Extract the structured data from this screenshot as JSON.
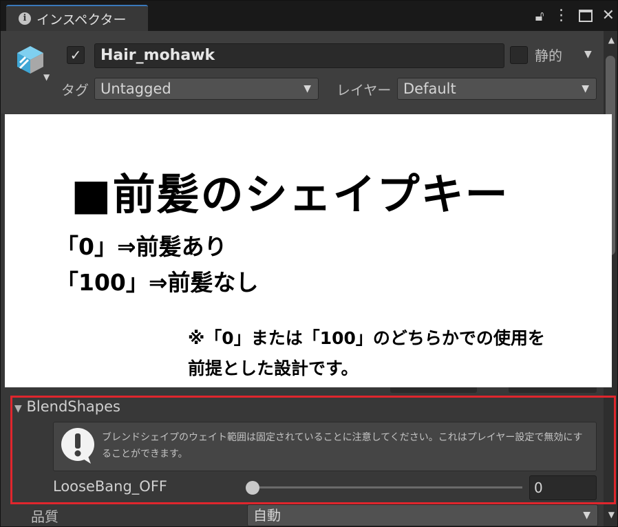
{
  "tab": {
    "title": "インスペクター",
    "icons": [
      "info-icon",
      "lock-icon",
      "kebab-menu-icon",
      "maximize-icon",
      "close-icon"
    ]
  },
  "object": {
    "active": true,
    "name": "Hair_mohawk",
    "static_label": "静的",
    "tag_label": "タグ",
    "tag_value": "Untagged",
    "layer_label": "レイヤー",
    "layer_value": "Default"
  },
  "overlay": {
    "title": "■前髪のシェイプキー",
    "line1": "「0」⇒前髪あり",
    "line2": "「100」⇒前髪なし",
    "note1": "※「0」または「100」のどちらかでの使用を",
    "note2": "前提とした設計です。"
  },
  "blendshapes": {
    "title": "BlendShapes",
    "help_text": "ブレンドシェイプのウェイト範囲は固定されていることに注意してください。これはプレイヤー設定で無効にすることができます。",
    "slider_label": "LooseBang_OFF",
    "slider_value": "0",
    "slider_fraction": 0
  },
  "quality": {
    "label": "品質",
    "value": "自動"
  },
  "colors": {
    "highlight_border": "#e0262d",
    "tab_accent": "#3a79bb",
    "panel_bg": "#383838"
  }
}
